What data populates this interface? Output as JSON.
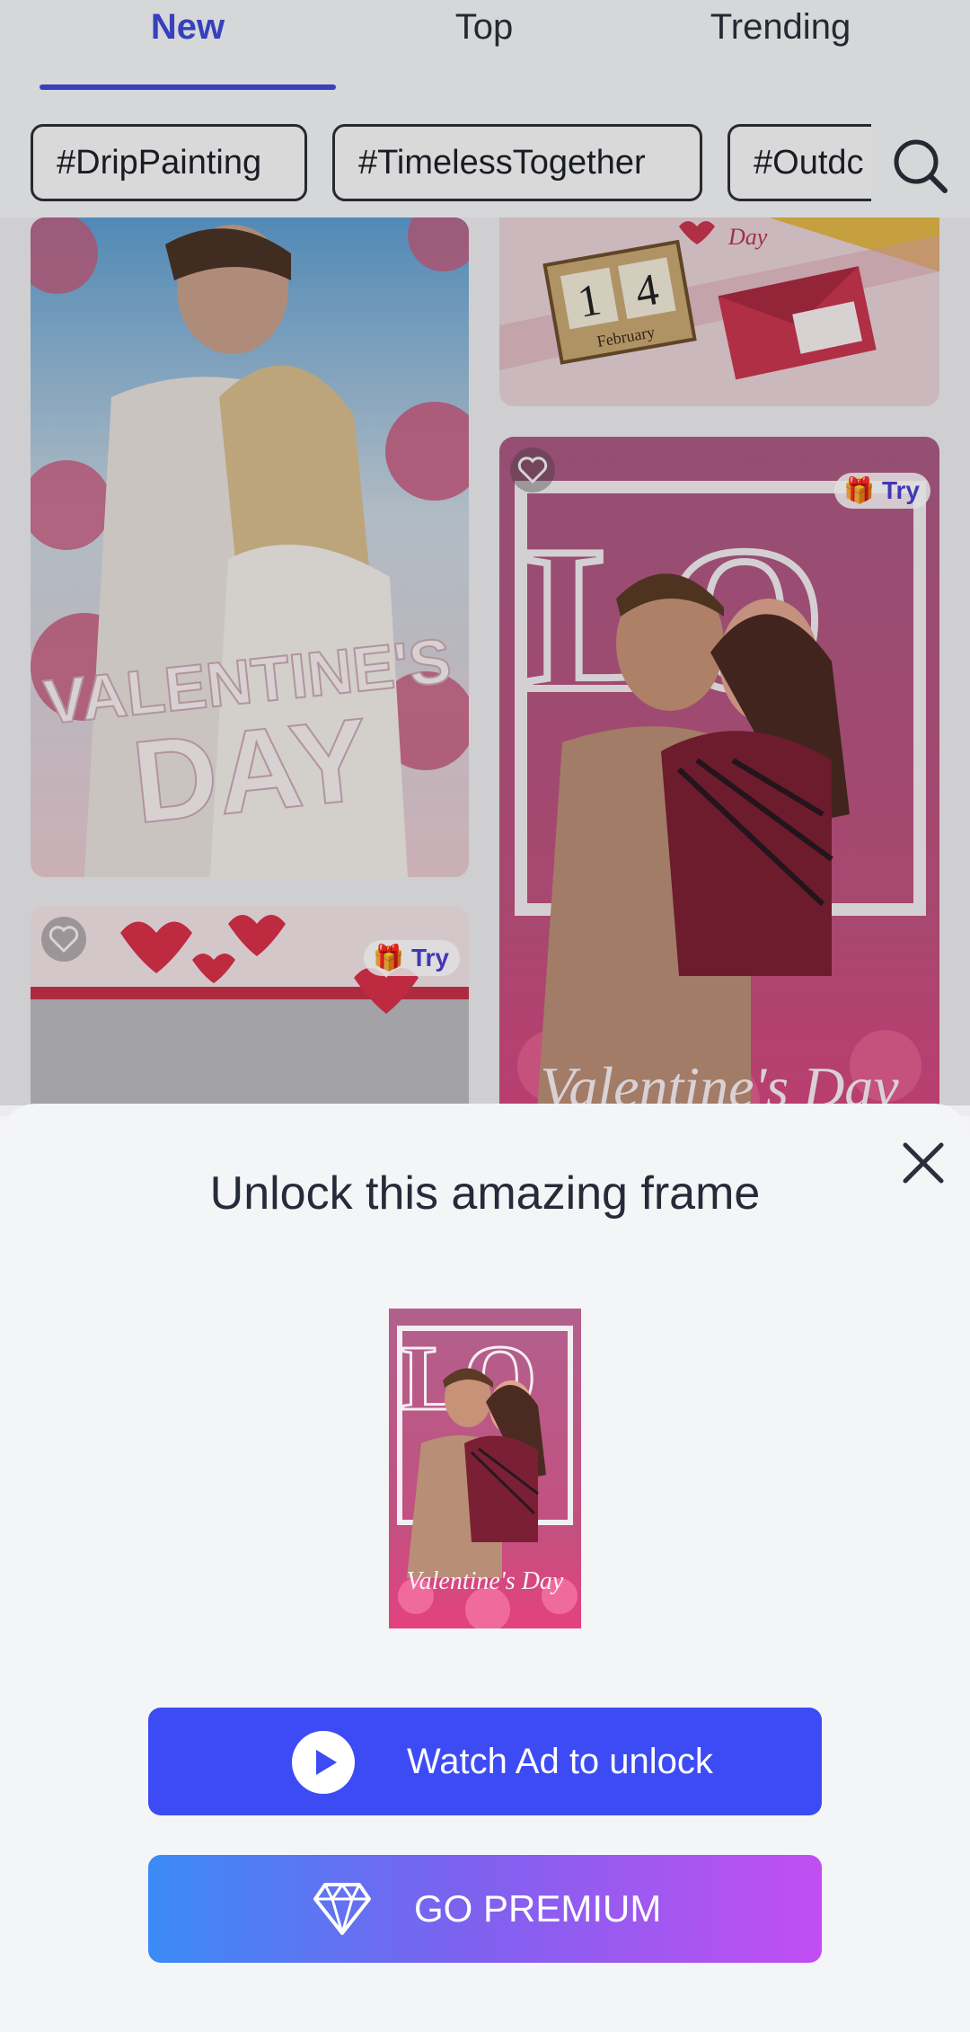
{
  "tabs": [
    {
      "label": "New",
      "active": true
    },
    {
      "label": "Top",
      "active": false
    },
    {
      "label": "Trending",
      "active": false
    }
  ],
  "hashtags": [
    "#DripPainting",
    "#TimelessTogether",
    "#Outdc"
  ],
  "cards": {
    "left_top": {
      "text_line1": "VALENTINE'S",
      "text_line2": "DAY"
    },
    "right_top": {
      "date_1": "1",
      "date_2": "4",
      "month": "February",
      "word": "Day"
    },
    "right_main": {
      "big_text": "LO",
      "script_text": "Valentine's Day",
      "try_label": "Try"
    },
    "left_bottom": {
      "try_label": "Try"
    }
  },
  "sheet": {
    "title": "Unlock this amazing frame",
    "preview_script_text": "Valentine's Day",
    "watch_ad_label": "Watch Ad to unlock",
    "premium_label": "GO PREMIUM"
  },
  "colors": {
    "accent": "#3f49d8",
    "watch_ad_button": "#3d4bf4",
    "premium_gradient_start": "#3a8bf6",
    "premium_gradient_end": "#c24ef2"
  }
}
